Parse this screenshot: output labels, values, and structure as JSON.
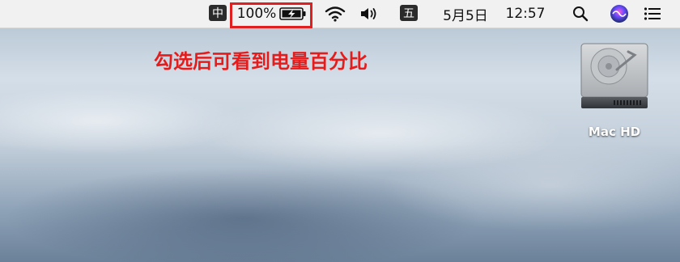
{
  "menubar": {
    "input_method": "中",
    "battery_percent": "100%",
    "wubi_input": "五",
    "date": "5月5日",
    "time": "12:57"
  },
  "annotation": {
    "text": "勾选后可看到电量百分比",
    "color": "#e51c1c"
  },
  "desktop": {
    "drive_label": "Mac HD"
  },
  "icons": [
    "battery-charging-icon",
    "wifi-icon",
    "volume-icon",
    "spotlight-search-icon",
    "siri-icon",
    "notification-center-icon",
    "hard-drive-icon"
  ]
}
